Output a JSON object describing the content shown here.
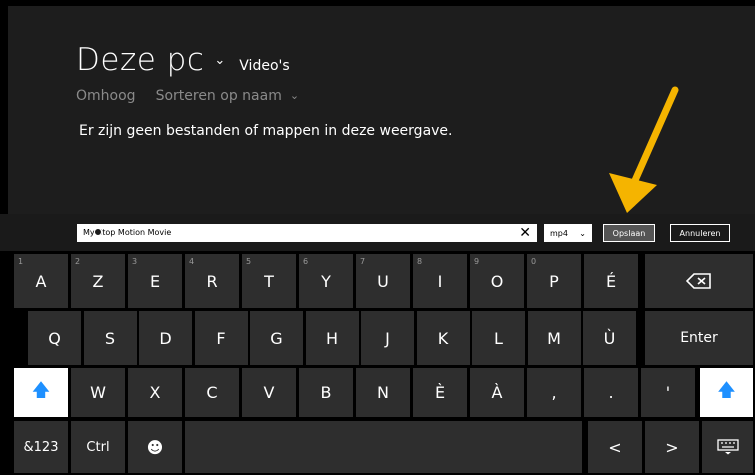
{
  "picker": {
    "title": "Deze pc",
    "title_chevron": "⌄",
    "subfolder": "Video's",
    "nav_up": "Omhoog",
    "sort": "Sorteren op naam",
    "sort_chevron": "⌄",
    "empty_message": "Er zijn geen bestanden of mappen in deze weergave."
  },
  "savebar": {
    "filename": "My Stop Motion Movie",
    "clear": "✕",
    "filetype": "mp4",
    "filetype_chevron": "⌄",
    "save_label": "Opslaan",
    "cancel_label": "Annuleren"
  },
  "annotation": {
    "arrow_color": "#f5b400"
  },
  "keyboard": {
    "row1": [
      {
        "label": "A",
        "digit": "1"
      },
      {
        "label": "Z",
        "digit": "2"
      },
      {
        "label": "E",
        "digit": "3"
      },
      {
        "label": "R",
        "digit": "4"
      },
      {
        "label": "T",
        "digit": "5"
      },
      {
        "label": "Y",
        "digit": "6"
      },
      {
        "label": "U",
        "digit": "7"
      },
      {
        "label": "I",
        "digit": "8"
      },
      {
        "label": "O",
        "digit": "9"
      },
      {
        "label": "P",
        "digit": "0"
      },
      {
        "label": "É",
        "digit": ""
      }
    ],
    "backspace_icon": "backspace-icon",
    "row2": [
      "Q",
      "S",
      "D",
      "F",
      "G",
      "H",
      "J",
      "K",
      "L",
      "M",
      "Ù"
    ],
    "enter": "Enter",
    "row3": [
      "W",
      "X",
      "C",
      "V",
      "B",
      "N",
      "È",
      "À",
      ",",
      ".",
      "'"
    ],
    "shift_icon": "shift-arrow-icon",
    "num_key": "&123",
    "ctrl_key": "Ctrl",
    "emoji_icon": "smiley-icon",
    "left_key": "<",
    "right_key": ">",
    "keyboard_icon": "keyboard-icon"
  }
}
